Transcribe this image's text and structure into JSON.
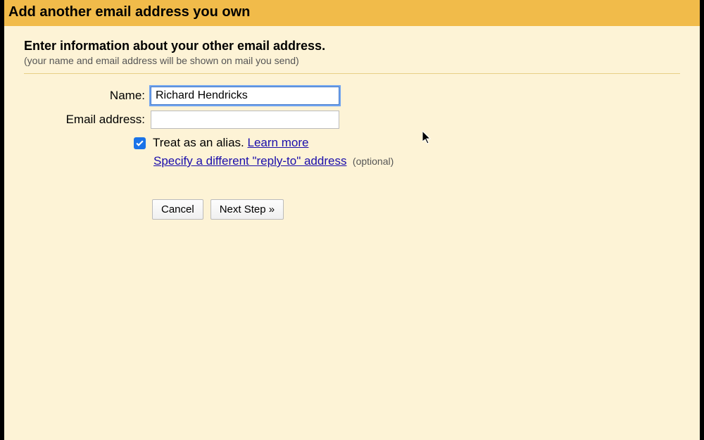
{
  "titlebar": {
    "title": "Add another email address you own"
  },
  "content": {
    "heading": "Enter information about your other email address.",
    "subheading": "(your name and email address will be shown on mail you send)"
  },
  "form": {
    "name_label": "Name:",
    "name_value": "Richard Hendricks",
    "email_label": "Email address:",
    "email_value": "",
    "alias_text": "Treat as an alias. ",
    "learn_more": "Learn more",
    "reply_to_link": "Specify a different \"reply-to\" address",
    "optional": "(optional)"
  },
  "buttons": {
    "cancel": "Cancel",
    "next": "Next Step »"
  }
}
